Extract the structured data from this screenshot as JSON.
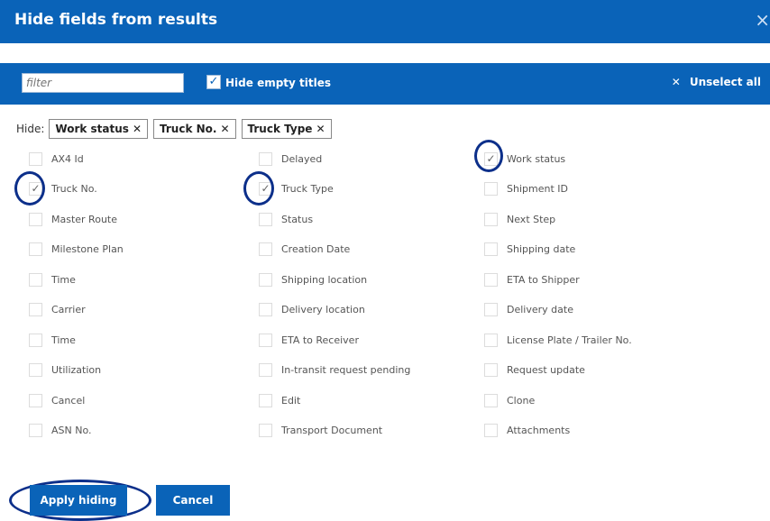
{
  "dialog": {
    "title": "Hide fields from results",
    "close": "×"
  },
  "toolbar": {
    "filter_placeholder": "filter",
    "hide_empty_label": "Hide empty titles",
    "hide_empty_check": "✓",
    "unselect_icon": "✕",
    "unselect_label": "Unselect all"
  },
  "hide": {
    "label": "Hide:",
    "tags": [
      {
        "label": "Work status",
        "x": "✕"
      },
      {
        "label": "Truck No.",
        "x": "✕"
      },
      {
        "label": "Truck Type",
        "x": "✕"
      }
    ]
  },
  "fields": [
    {
      "label": "AX4 Id",
      "checked": false
    },
    {
      "label": "Delayed",
      "checked": false
    },
    {
      "label": "Work status",
      "checked": true
    },
    {
      "label": "Truck No.",
      "checked": true
    },
    {
      "label": "Truck Type",
      "checked": true
    },
    {
      "label": "Shipment ID",
      "checked": false
    },
    {
      "label": "Master Route",
      "checked": false
    },
    {
      "label": "Status",
      "checked": false
    },
    {
      "label": "Next Step",
      "checked": false
    },
    {
      "label": "Milestone Plan",
      "checked": false
    },
    {
      "label": "Creation Date",
      "checked": false
    },
    {
      "label": "Shipping date",
      "checked": false
    },
    {
      "label": "Time",
      "checked": false
    },
    {
      "label": "Shipping location",
      "checked": false
    },
    {
      "label": "ETA to Shipper",
      "checked": false
    },
    {
      "label": "Carrier",
      "checked": false
    },
    {
      "label": "Delivery location",
      "checked": false
    },
    {
      "label": "Delivery date",
      "checked": false
    },
    {
      "label": "Time",
      "checked": false
    },
    {
      "label": "ETA to Receiver",
      "checked": false
    },
    {
      "label": "License Plate / Trailer No.",
      "checked": false
    },
    {
      "label": "Utilization",
      "checked": false
    },
    {
      "label": "In-transit request pending",
      "checked": false
    },
    {
      "label": "Request update",
      "checked": false
    },
    {
      "label": "Cancel",
      "checked": false
    },
    {
      "label": "Edit",
      "checked": false
    },
    {
      "label": "Clone",
      "checked": false
    },
    {
      "label": "ASN No.",
      "checked": false
    },
    {
      "label": "Transport Document",
      "checked": false
    },
    {
      "label": "Attachments",
      "checked": false
    }
  ],
  "buttons": {
    "apply": "Apply hiding",
    "cancel": "Cancel"
  },
  "colors": {
    "primary": "#0a63b8",
    "annotation": "#0c2f8a"
  }
}
